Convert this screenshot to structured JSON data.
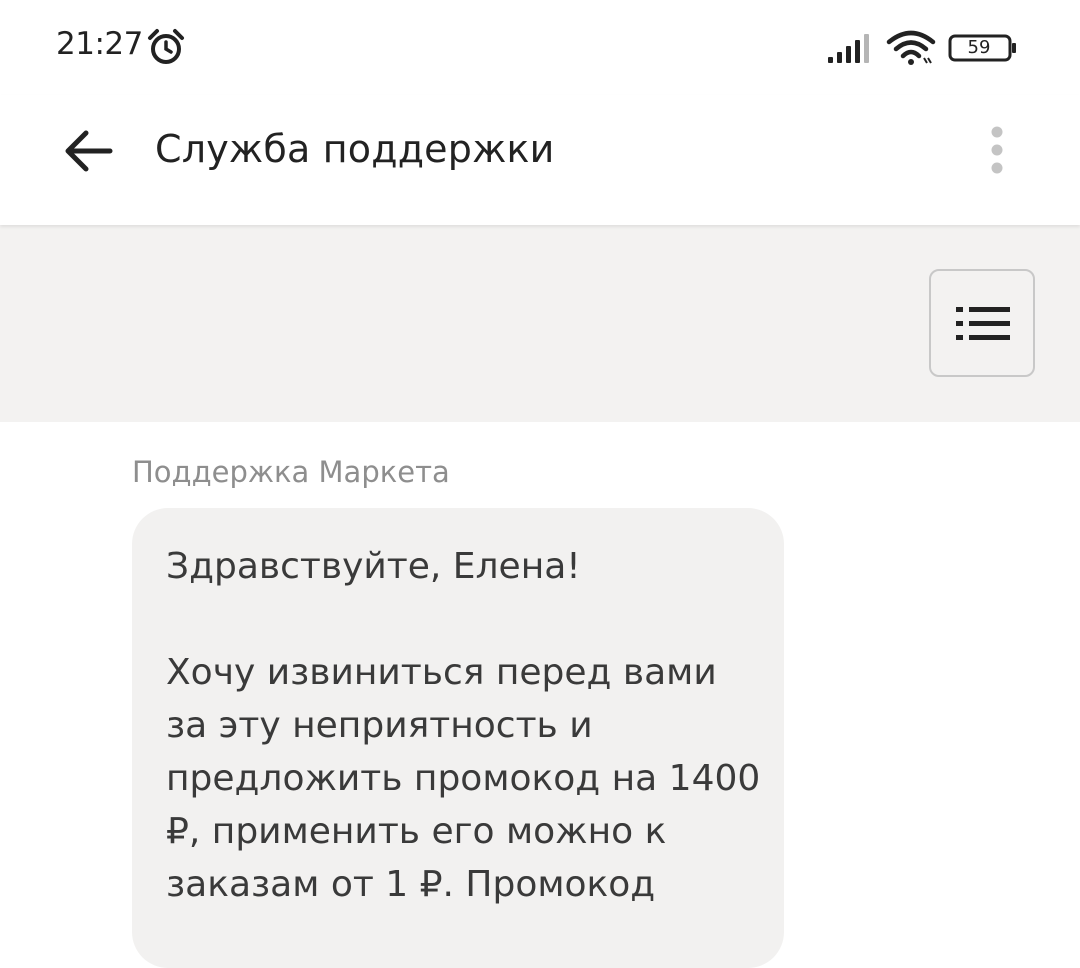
{
  "status_bar": {
    "time": "21:27",
    "battery": "59",
    "icons": [
      "alarm-clock-icon",
      "signal-icon",
      "wifi-icon",
      "battery-icon"
    ]
  },
  "app_bar": {
    "title": "Служба поддержки",
    "icons": [
      "back-arrow-icon",
      "more-vertical-icon"
    ]
  },
  "toolbar": {
    "icons": [
      "list-icon"
    ]
  },
  "chat": {
    "messages": [
      {
        "sender": "Поддержка Маркета",
        "greeting": "Здравствуйте, Елена!",
        "body": "Хочу извиниться перед вами за эту неприятность и предложить промокод на 1400 ₽, применить его можно к заказам от 1 ₽. Промокод"
      }
    ]
  },
  "colors": {
    "text": "#222222",
    "secondary_text": "#8e8e8e",
    "toolbar_bg": "#f3f2f1",
    "bubble_bg": "#f2f1f0",
    "border": "#c8c8c8"
  }
}
